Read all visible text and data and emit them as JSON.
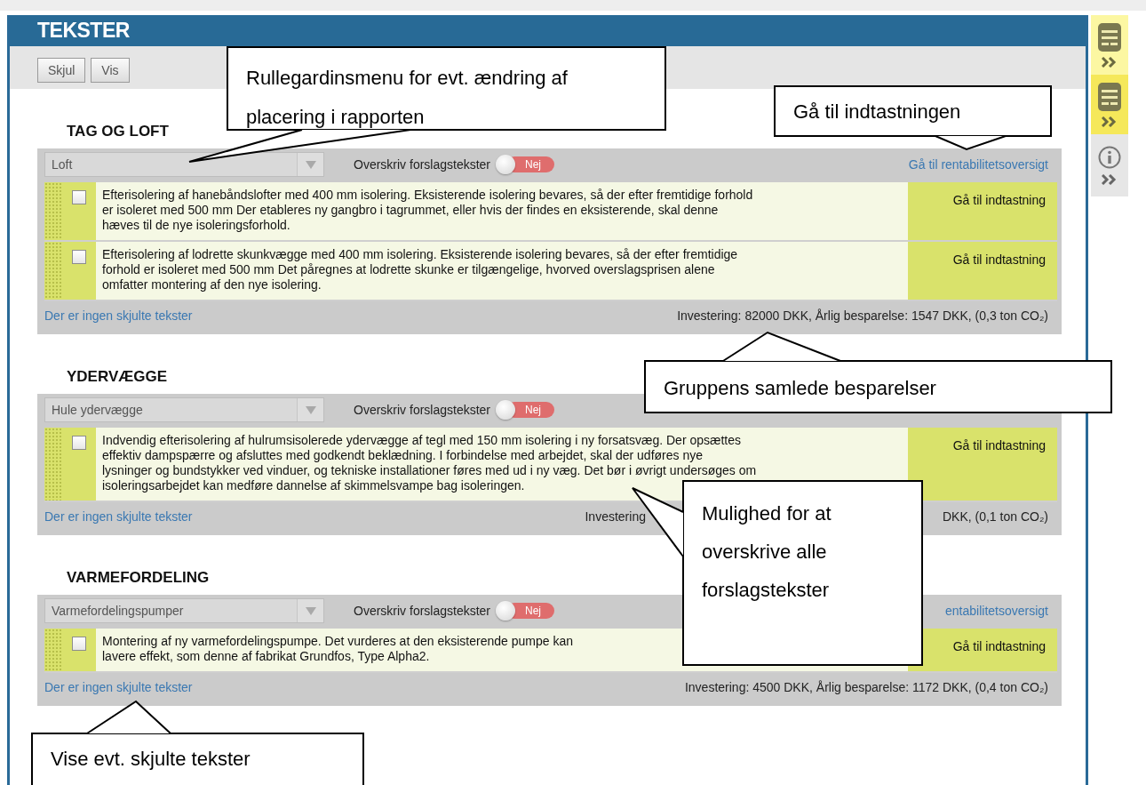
{
  "header": {
    "title": "TEKSTER"
  },
  "toolbar": {
    "buttons": [
      "Skjul",
      "Vis"
    ]
  },
  "sidebar": {
    "items": [
      {
        "kind": "list",
        "selected": false
      },
      {
        "kind": "list",
        "selected": true
      },
      {
        "kind": "info",
        "selected": false
      }
    ]
  },
  "groups": [
    {
      "title": "TAG OG LOFT",
      "dropdown": "Loft",
      "overwrite_label": "Overskriv forslagstekster",
      "toggle": {
        "on": false,
        "label": "Nej"
      },
      "link": "Gå til rentabilitetsoversigt",
      "items": [
        {
          "checked": false,
          "lines": [
            "Efterisolering af hanebåndslofter med 400 mm isolering. Eksisterende isolering bevares, så der efter fremtidige forhold",
            "er isoleret med 500 mm Der etableres ny gangbro i tagrummet, eller hvis der findes en eksisterende, skal denne",
            "hæves til de nye isoleringsforhold."
          ],
          "action": "Gå til indtastning"
        },
        {
          "checked": false,
          "lines": [
            "Efterisolering af lodrette skunkvægge med 400 mm isolering. Eksisterende isolering bevares, så der efter fremtidige",
            "forhold er isoleret med 500 mm Det påregnes at lodrette skunke er tilgængelige, hvorved overslagsprisen alene",
            "omfatter montering af den nye isolering."
          ],
          "action": "Gå til indtastning"
        }
      ],
      "hidden_link": "Der er ingen skjulte tekster",
      "summary": [
        "Investering: 82000 DKK, Årlig besparelse: 1547 DKK, (0,3 ton CO₂)"
      ]
    },
    {
      "title": "YDERVÆGGE",
      "dropdown": "Hule ydervægge",
      "overwrite_label": "Overskriv forslagstekster",
      "toggle": {
        "on": false,
        "label": "Nej"
      },
      "items": [
        {
          "checked": false,
          "lines": [
            "Indvendig efterisolering af hulrumsisolerede ydervægge af tegl med 150 mm isolering i ny forsatsvæg. Der opsættes",
            "effektiv dampspærre og afsluttes med godkendt beklædning. I forbindelse med arbejdet, skal der udføres nye",
            "lysninger og bundstykker ved vinduer, og tekniske installationer føres med ud i ny væg. Det bør i øvrigt undersøges om",
            "isoleringsarbejdet kan medføre dannelse af skimmelsvampe bag isoleringen."
          ],
          "action": "Gå til indtastning"
        }
      ],
      "hidden_link": "Der er ingen skjulte tekster",
      "summary": [
        "Investering",
        "DKK, (0,1 ton CO₂)"
      ]
    },
    {
      "title": "VARMEFORDELING",
      "dropdown": "Varmefordelingspumper",
      "overwrite_label": "Overskriv forslagstekster",
      "toggle": {
        "on": false,
        "label": "Nej"
      },
      "link": "entabilitetsoversigt",
      "items": [
        {
          "checked": false,
          "lines": [
            "Montering af ny varmefordelingspumpe. Det vurderes at den eksisterende pumpe kan",
            "lavere effekt, som denne af fabrikat Grundfos, Type Alpha2."
          ],
          "action": "Gå til indtastning"
        }
      ],
      "hidden_link": "Der er ingen skjulte tekster",
      "summary": [
        "Investering: 4500 DKK, Årlig besparelse: 1172 DKK, (0,4 ton CO₂)"
      ]
    }
  ],
  "callouts": [
    {
      "text": "Rullegardinsmenu for evt. ændring af placering i rapporten"
    },
    {
      "text": "Gå til indtastningen"
    },
    {
      "text": "Gruppens samlede besparelser"
    },
    {
      "text": "Mulighed for at overskrive alle forslagstekster"
    },
    {
      "text": "Vise evt. skjulte tekster"
    }
  ]
}
